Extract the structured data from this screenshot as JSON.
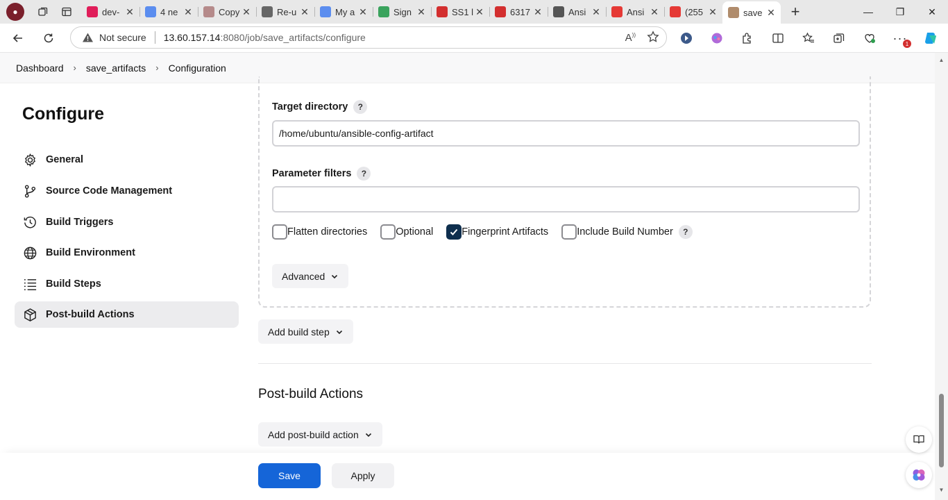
{
  "browser": {
    "tabs": [
      {
        "title": "dev-",
        "favicon_color": "#e01e5a"
      },
      {
        "title": "4 ne",
        "favicon_color": "#5b8def"
      },
      {
        "title": "Copy",
        "favicon_color": "#b58a8a"
      },
      {
        "title": "Re-u",
        "favicon_color": "#666666"
      },
      {
        "title": "My a",
        "favicon_color": "#5b8def"
      },
      {
        "title": "Sign",
        "favicon_color": "#3aa35d"
      },
      {
        "title": "SS1 l",
        "favicon_color": "#d32f2f"
      },
      {
        "title": "6317",
        "favicon_color": "#d32f2f"
      },
      {
        "title": "Ansi",
        "favicon_color": "#555555"
      },
      {
        "title": "Ansi",
        "favicon_color": "#e53935"
      },
      {
        "title": "(255",
        "favicon_color": "#e53935"
      },
      {
        "title": "save",
        "favicon_color": "#b08c6c"
      }
    ],
    "security_label": "Not secure",
    "url_host": "13.60.157.14",
    "url_rest": ":8080/job/save_artifacts/configure",
    "notification_badge": "1"
  },
  "breadcrumb": {
    "items": [
      "Dashboard",
      "save_artifacts",
      "Configuration"
    ]
  },
  "sidebar": {
    "title": "Configure",
    "items": [
      {
        "label": "General",
        "icon": "gear-icon"
      },
      {
        "label": "Source Code Management",
        "icon": "branch-icon"
      },
      {
        "label": "Build Triggers",
        "icon": "clock-icon"
      },
      {
        "label": "Build Environment",
        "icon": "globe-icon"
      },
      {
        "label": "Build Steps",
        "icon": "list-icon"
      },
      {
        "label": "Post-build Actions",
        "icon": "package-icon"
      }
    ],
    "active_index": 5
  },
  "main": {
    "target_directory": {
      "label": "Target directory",
      "value": "/home/ubuntu/ansible-config-artifact"
    },
    "parameter_filters": {
      "label": "Parameter filters",
      "value": ""
    },
    "checkboxes": [
      {
        "label": "Flatten directories",
        "checked": false
      },
      {
        "label": "Optional",
        "checked": false
      },
      {
        "label": "Fingerprint Artifacts",
        "checked": true
      },
      {
        "label": "Include Build Number",
        "checked": false
      }
    ],
    "help_glyph": "?",
    "advanced_label": "Advanced",
    "add_build_step_label": "Add build step",
    "post_build_title": "Post-build Actions",
    "add_post_build_label": "Add post-build action"
  },
  "footer": {
    "save_label": "Save",
    "apply_label": "Apply"
  }
}
